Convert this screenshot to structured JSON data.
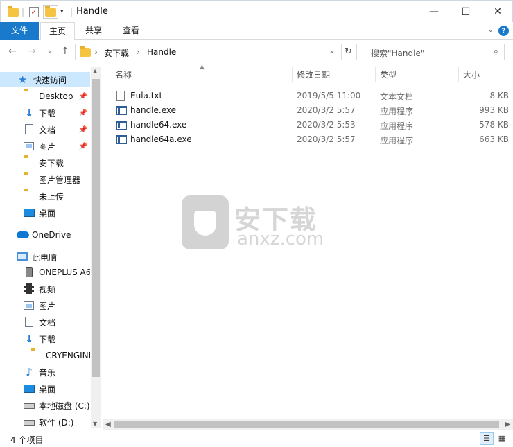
{
  "window": {
    "title": "Handle",
    "controls": {
      "minimize": "—",
      "maximize": "☐",
      "close": "✕"
    }
  },
  "ribbon": {
    "tabs": [
      "文件",
      "主页",
      "共享",
      "查看"
    ],
    "help": "?"
  },
  "address": {
    "segments": [
      "安下载",
      "Handle"
    ],
    "separator": "›",
    "search_placeholder": "搜索\"Handle\""
  },
  "sidebar": {
    "quick_access": "快速访问",
    "quick_items": [
      "Desktop",
      "下载",
      "文档",
      "图片",
      "安下载",
      "图片管理器",
      "未上传",
      "桌面"
    ],
    "onedrive": "OneDrive",
    "this_pc": "此电脑",
    "pc_items": [
      "ONEPLUS A6",
      "视频",
      "图片",
      "文档",
      "下载",
      "CRYENGINE",
      "音乐",
      "桌面",
      "本地磁盘 (C:)",
      "软件 (D:)"
    ]
  },
  "columns": {
    "name": "名称",
    "date": "修改日期",
    "type": "类型",
    "size": "大小"
  },
  "files": [
    {
      "name": "Eula.txt",
      "date": "2019/5/5 11:00",
      "type": "文本文档",
      "size": "8 KB",
      "icon": "text-file-icon"
    },
    {
      "name": "handle.exe",
      "date": "2020/3/2 5:57",
      "type": "应用程序",
      "size": "993 KB",
      "icon": "exe-file-icon"
    },
    {
      "name": "handle64.exe",
      "date": "2020/3/2 5:53",
      "type": "应用程序",
      "size": "578 KB",
      "icon": "exe-file-icon"
    },
    {
      "name": "handle64a.exe",
      "date": "2020/3/2 5:57",
      "type": "应用程序",
      "size": "663 KB",
      "icon": "exe-file-icon"
    }
  ],
  "watermark": {
    "cn": "安下载",
    "en": "anxz.com"
  },
  "status": {
    "count": "4 个项目"
  },
  "colors": {
    "accent": "#1979ca",
    "selected": "#cce8ff",
    "folder": "#f5c542"
  }
}
